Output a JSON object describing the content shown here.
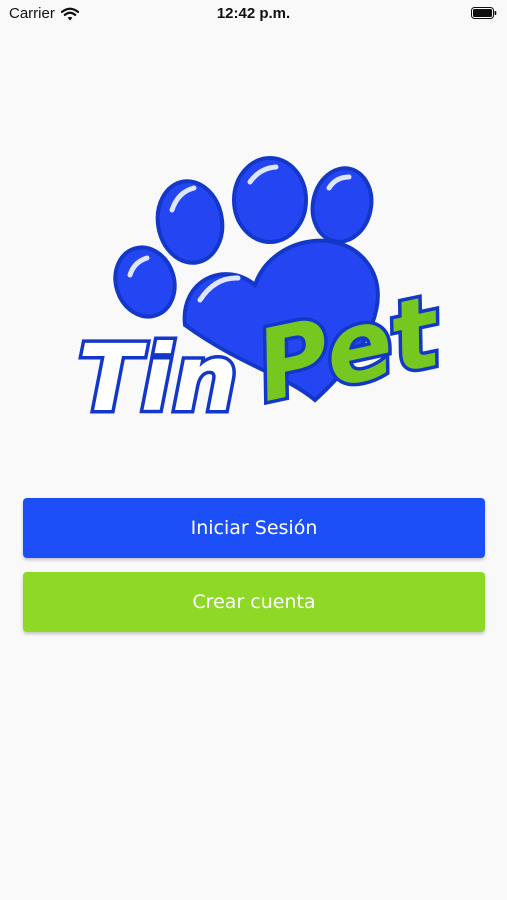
{
  "status_bar": {
    "carrier": "Carrier",
    "time": "12:42 p.m.",
    "wifi_icon": "wifi-icon",
    "battery_icon": "battery-icon"
  },
  "logo": {
    "text_part1": "Tin",
    "text_part2": "Pet",
    "icon": "paw-icon",
    "colors": {
      "blue": "#2446f2",
      "green": "#77c721",
      "outline": "#1337c9"
    }
  },
  "actions": {
    "login_label": "Iniciar Sesión",
    "signup_label": "Crear cuenta"
  },
  "colors": {
    "login_button": "#1d4ff9",
    "signup_button": "#8ed826",
    "background": "#f9f9f9"
  }
}
